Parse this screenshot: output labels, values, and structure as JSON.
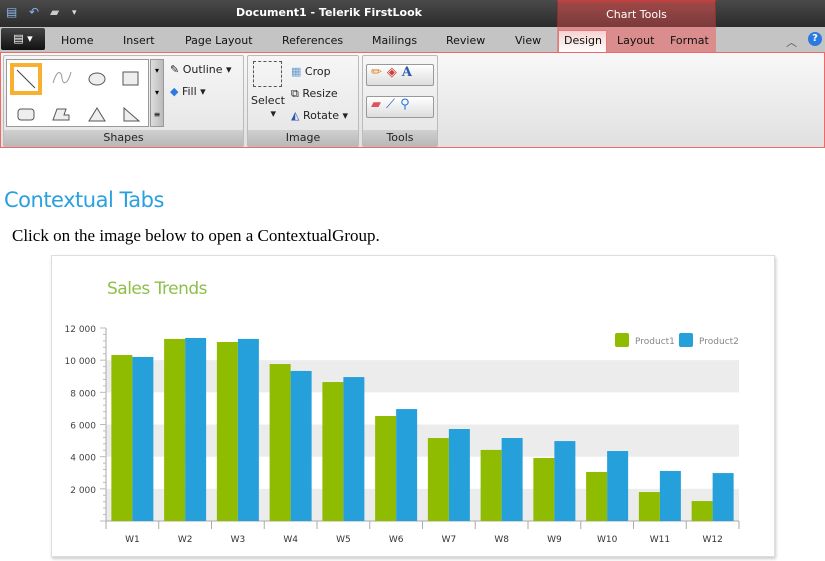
{
  "window": {
    "title": "Document1 - Telerik FirstLook"
  },
  "quick_access": {
    "icons": [
      "copy-icon",
      "undo-icon",
      "print-icon",
      "customize-dropdown-icon"
    ]
  },
  "context_group": {
    "label": "Chart Tools",
    "tabs": [
      "Design",
      "Layout",
      "Format"
    ],
    "color": "#d98a8a"
  },
  "tabs": [
    "Home",
    "Insert",
    "Page Layout",
    "References",
    "Mailings",
    "Review",
    "View"
  ],
  "ribbon": {
    "shapes": {
      "label": "Shapes",
      "outline": "Outline",
      "fill": "Fill"
    },
    "image": {
      "label": "Image",
      "select": "Select",
      "crop": "Crop",
      "resize": "Resize",
      "rotate": "Rotate"
    },
    "tools": {
      "label": "Tools"
    }
  },
  "content": {
    "heading": "Contextual Tabs",
    "intro": "Click on the image below to open a ContextualGroup."
  },
  "chart_data": {
    "type": "bar",
    "title": "Sales Trends",
    "categories": [
      "W1",
      "W2",
      "W3",
      "W4",
      "W5",
      "W6",
      "W7",
      "W8",
      "W9",
      "W10",
      "W11",
      "W12"
    ],
    "series": [
      {
        "name": "Product1",
        "color": "#8fbc00",
        "values": [
          10320,
          11320,
          11130,
          9760,
          8640,
          6530,
          5160,
          4420,
          3920,
          3050,
          1800,
          1240
        ]
      },
      {
        "name": "Product2",
        "color": "#26a0da",
        "values": [
          10200,
          11380,
          11320,
          9330,
          8950,
          6960,
          5720,
          5160,
          4970,
          4350,
          3110,
          2980
        ]
      }
    ],
    "ylim": [
      0,
      12000
    ],
    "yticks": [
      "2 000",
      "4 000",
      "6 000",
      "8 000",
      "10 000",
      "12 000"
    ],
    "ytick_values": [
      2000,
      4000,
      6000,
      8000,
      10000,
      12000
    ],
    "legend": "top-right",
    "grid": "alternating bands"
  }
}
